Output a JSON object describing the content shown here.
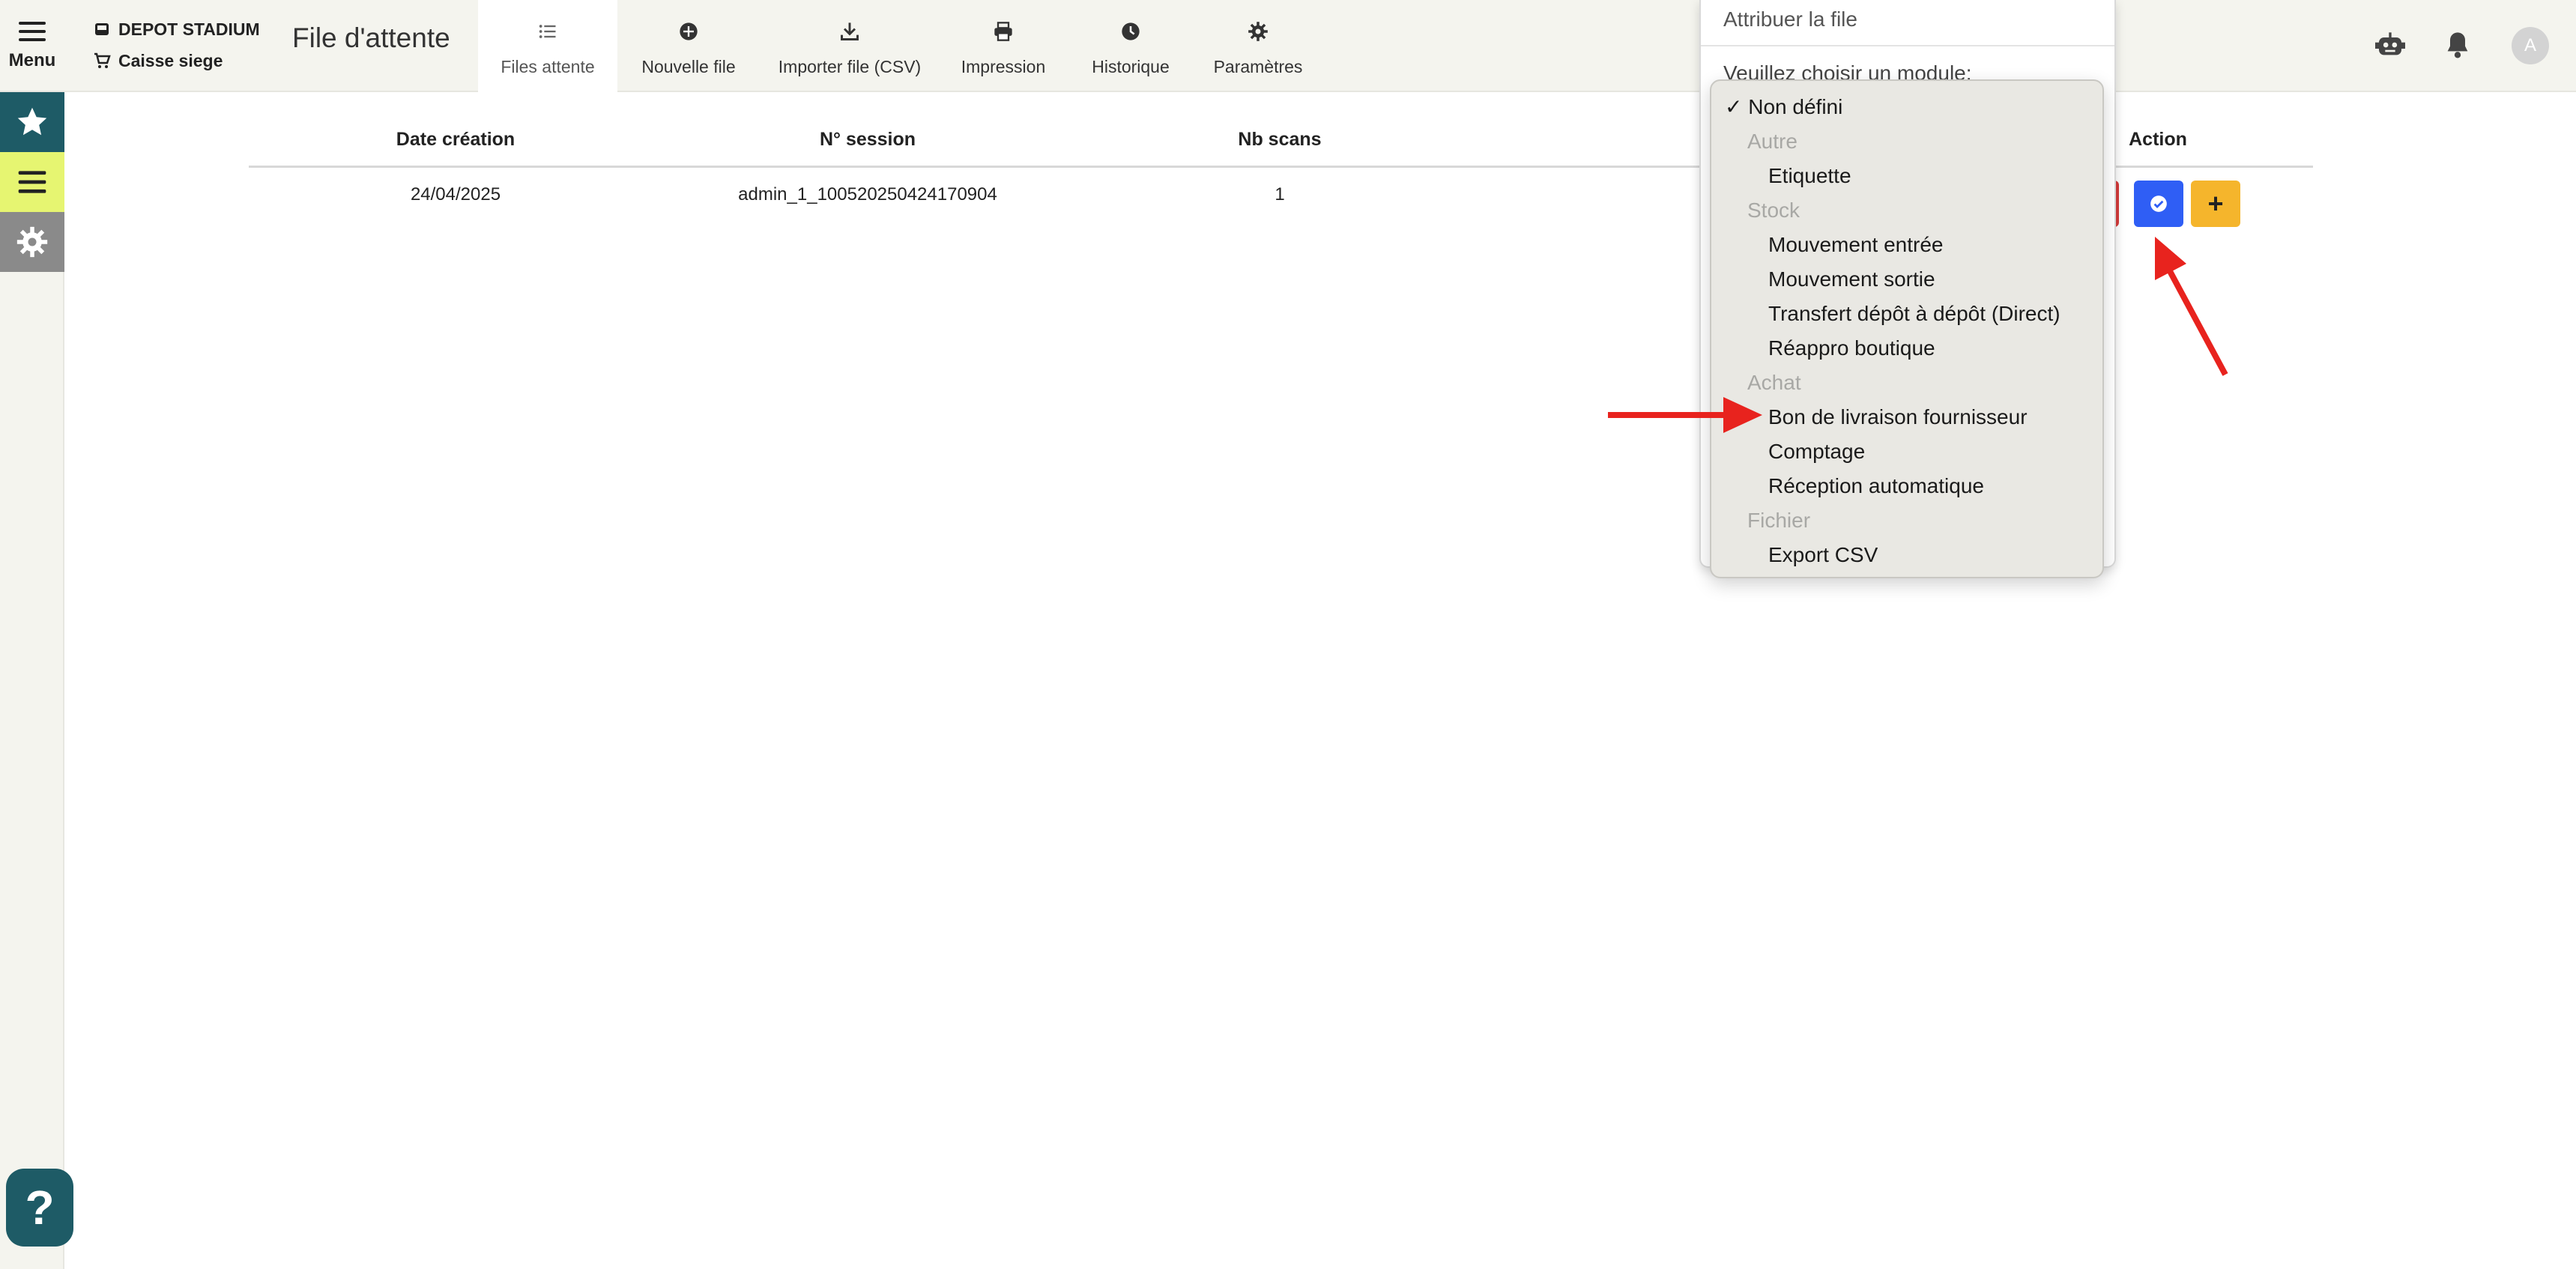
{
  "header": {
    "menu_label": "Menu",
    "store_name": "DEPOT STADIUM",
    "register_name": "Caisse siege",
    "page_title": "File d'attente"
  },
  "tabs": [
    {
      "label": "Files attente",
      "icon": "list-icon",
      "active": true
    },
    {
      "label": "Nouvelle file",
      "icon": "plus-circle-icon"
    },
    {
      "label": "Importer file (CSV)",
      "icon": "download-icon"
    },
    {
      "label": "Impression",
      "icon": "printer-icon"
    },
    {
      "label": "Historique",
      "icon": "clock-icon"
    },
    {
      "label": "Paramètres",
      "icon": "gear-icon"
    }
  ],
  "topright": {
    "avatar_letter": "A"
  },
  "table": {
    "columns": [
      "Date création",
      "N° session",
      "Nb scans",
      "Action"
    ],
    "rows": [
      {
        "date": "24/04/2025",
        "session": "admin_1_100520250424170904",
        "scans": "1"
      }
    ],
    "plus_label": "+"
  },
  "modal": {
    "title": "Attribuer la file",
    "prompt": "Veuillez choisir un module:"
  },
  "dropdown": {
    "selected_mark": "✓",
    "selected": "Non défini",
    "groups": [
      {
        "label": "Autre",
        "items": [
          "Etiquette"
        ]
      },
      {
        "label": "Stock",
        "items": [
          "Mouvement entrée",
          "Mouvement sortie",
          "Transfert dépôt à dépôt (Direct)",
          "Réappro boutique"
        ]
      },
      {
        "label": "Achat",
        "items": [
          "Bon de livraison fournisseur",
          "Comptage",
          "Réception automatique"
        ]
      },
      {
        "label": "Fichier",
        "items": [
          "Export CSV"
        ]
      }
    ]
  },
  "help_label": "?",
  "colors": {
    "accent_teal": "#1e5b66",
    "accent_lime": "#e6f571",
    "button_blue": "#2f5ef5",
    "button_yellow": "#f5b52c",
    "annotation_red": "#e8231e"
  }
}
